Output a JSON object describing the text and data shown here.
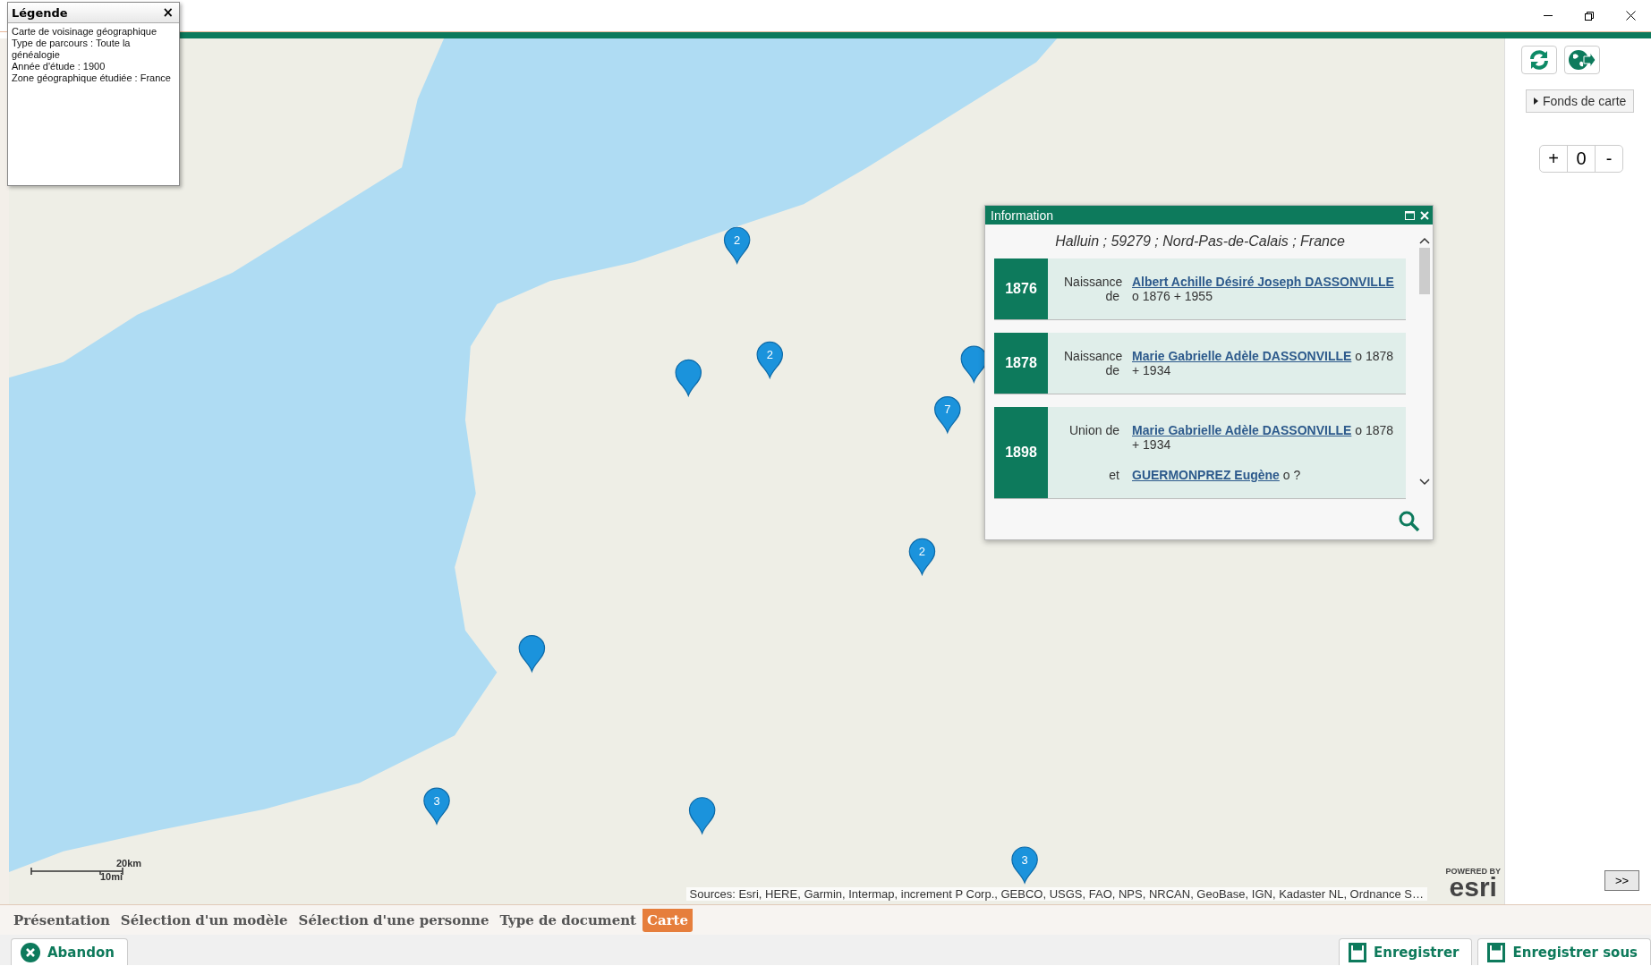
{
  "legend": {
    "title": "Légende",
    "close": "×",
    "lines": [
      "Carte de voisinage géographique",
      "Type de parcours :  Toute la généalogie",
      "Année d'étude : 1900",
      "Zone géographique étudiée : France"
    ]
  },
  "map": {
    "markers": [
      {
        "kind": "cluster",
        "count": "2"
      },
      {
        "kind": "cluster",
        "count": "2"
      },
      {
        "kind": "pin"
      },
      {
        "kind": "pin"
      },
      {
        "kind": "cluster",
        "count": "7"
      },
      {
        "kind": "cluster",
        "count": "2"
      },
      {
        "kind": "pin"
      },
      {
        "kind": "cluster",
        "count": "3"
      },
      {
        "kind": "pin"
      },
      {
        "kind": "cluster",
        "count": "3"
      }
    ],
    "scale": {
      "metric": "20km",
      "imperial": "10mi"
    },
    "attribution": "Sources: Esri, HERE, Garmin, Intermap, increment P Corp., GEBCO, USGS, FAO, NPS, NRCAN, GeoBase, IGN, Kadaster NL, Ordnance S…",
    "logo": {
      "caption": "POWERED BY",
      "name": "esri"
    }
  },
  "info": {
    "title": "Information",
    "location": "Halluin ; 59279 ; Nord-Pas-de-Calais ; France",
    "events": [
      {
        "year": "1876",
        "entries": [
          {
            "label": "Naissance de",
            "person": "Albert Achille Désiré Joseph DASSONVILLE",
            "details": "o 1876 + 1955"
          }
        ]
      },
      {
        "year": "1878",
        "entries": [
          {
            "label": "Naissance de",
            "person": "Marie Gabrielle Adèle DASSONVILLE",
            "details": "o 1878 + 1934"
          }
        ]
      },
      {
        "year": "1898",
        "entries": [
          {
            "label": "Union de",
            "person": "Marie Gabrielle Adèle DASSONVILLE",
            "details": "o 1878 + 1934"
          },
          {
            "label": "et",
            "person": "GUERMONPREZ Eugène",
            "details": "o ?"
          }
        ]
      }
    ]
  },
  "side": {
    "basemap_button": "Fonds de carte",
    "zoom": {
      "plus": "+",
      "level": "0",
      "minus": "-"
    },
    "expand_button": ">>"
  },
  "tabs": [
    {
      "label": "Présentation",
      "selected": false
    },
    {
      "label": "Sélection d'un modèle",
      "selected": false
    },
    {
      "label": "Sélection d'une personne",
      "selected": false
    },
    {
      "label": "Type de document",
      "selected": false
    },
    {
      "label": "Carte",
      "selected": true
    }
  ],
  "actions": [
    {
      "label": "Abandon",
      "kind": "cancel"
    },
    {
      "label": "Enregistrer",
      "kind": "save"
    },
    {
      "label": "Enregistrer sous",
      "kind": "save"
    }
  ]
}
